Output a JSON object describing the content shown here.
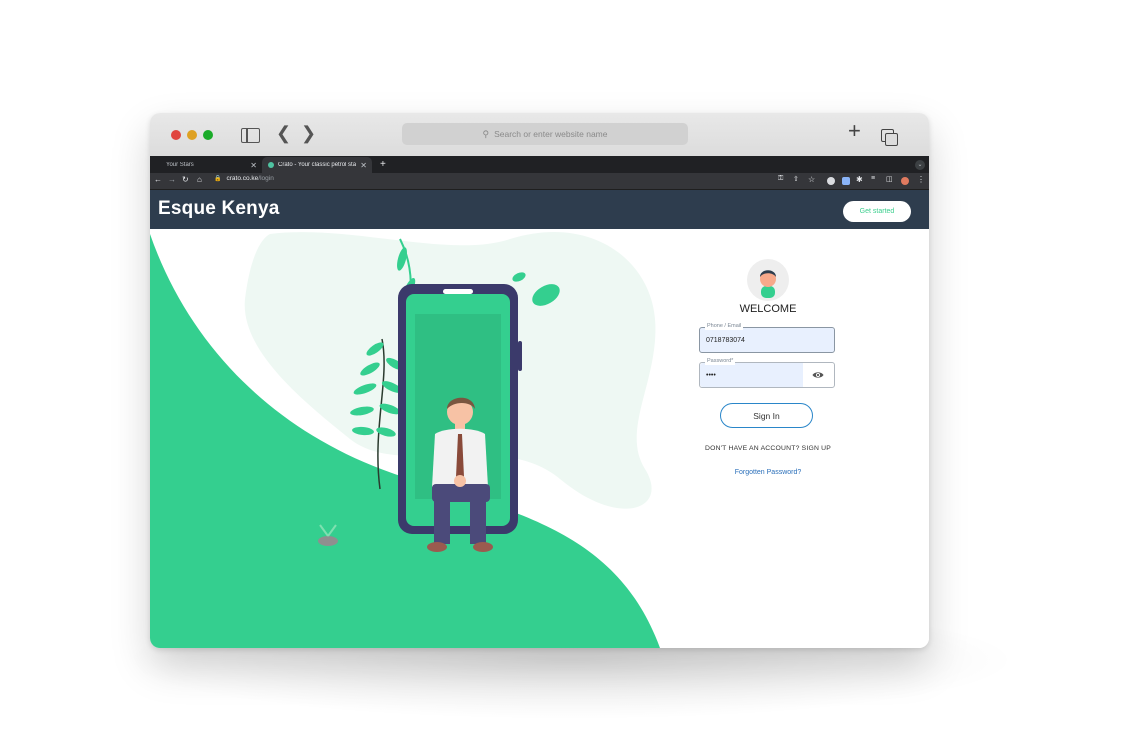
{
  "safari": {
    "search_placeholder": "Search or enter website name"
  },
  "tabs": [
    {
      "label": "Your Stars"
    },
    {
      "label": "Crato - Your classic petrol sta"
    }
  ],
  "address_bar": {
    "domain": "crato.co.ke",
    "path": "/login"
  },
  "site": {
    "brand": "Esque Kenya",
    "cta_label": "Get started"
  },
  "login": {
    "welcome": "WELCOME",
    "phone_label": "Phone / Email",
    "phone_value": "0718783074",
    "password_label": "Password*",
    "password_value": "••••",
    "signin_label": "Sign In",
    "signup_text": "DON'T HAVE AN ACCOUNT? SIGN UP",
    "forgot_text": "Forgotten Password?"
  },
  "colors": {
    "accent_green": "#3ccf8e",
    "header_bg": "#2e3d4e",
    "link_blue": "#2a6fba"
  }
}
